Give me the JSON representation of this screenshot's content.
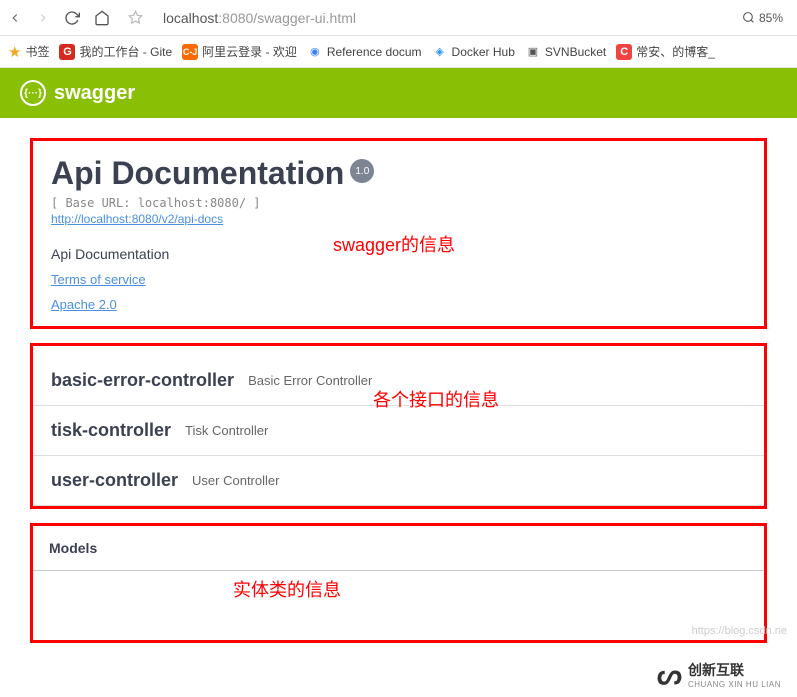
{
  "browser": {
    "url_host": "localhost",
    "url_rest": ":8080/swagger-ui.html",
    "zoom": "85%"
  },
  "bookmarks": [
    {
      "label": "书签"
    },
    {
      "label": "我的工作台 - Gite"
    },
    {
      "label": "阿里云登录 - 欢迎"
    },
    {
      "label": "Reference docum"
    },
    {
      "label": "Docker Hub"
    },
    {
      "label": "SVNBucket"
    },
    {
      "label": "常安、的博客_"
    }
  ],
  "swagger": {
    "brand": "swagger",
    "title": "Api Documentation",
    "version": "1.0",
    "base_url": "[ Base URL: localhost:8080/ ]",
    "api_docs_url": "http://localhost:8080/v2/api-docs",
    "description": "Api Documentation",
    "terms_label": "Terms of service",
    "license_label": "Apache 2.0"
  },
  "annotations": {
    "info": "swagger的信息",
    "controllers": "各个接口的信息",
    "models": "实体类的信息"
  },
  "controllers": [
    {
      "name": "basic-error-controller",
      "desc": "Basic Error Controller"
    },
    {
      "name": "tisk-controller",
      "desc": "Tisk Controller"
    },
    {
      "name": "user-controller",
      "desc": "User Controller"
    }
  ],
  "models_label": "Models",
  "watermark": "https://blog.csdn.ne",
  "footer_brand": "创新互联",
  "footer_sub": "CHUANG XIN HU LIAN"
}
